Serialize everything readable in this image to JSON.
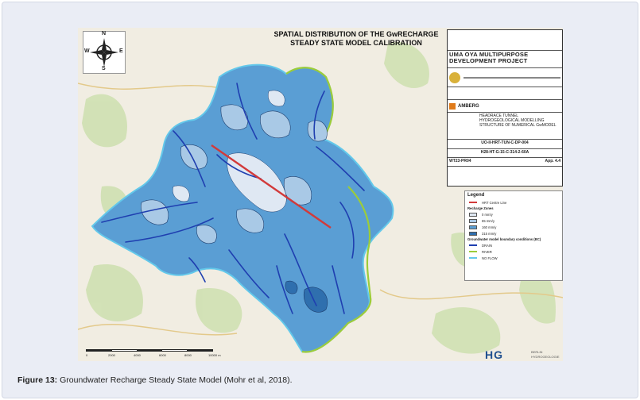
{
  "map": {
    "title_line1": "SPATIAL DISTRIBUTION OF THE GwRECHARGE",
    "title_line2": "STEADY STATE MODEL CALIBRATION",
    "compass": {
      "north": "N",
      "south": "S",
      "east": "E",
      "west": "W"
    },
    "scale_labels": [
      "0",
      "2000",
      "4000",
      "6000",
      "8000",
      "10000 m"
    ],
    "colors": {
      "zone_0": "#dfe8f3",
      "zone_65": "#a9c9e6",
      "zone_160": "#5a9ed4",
      "zone_315": "#2f6fae",
      "hrt_line": "#d23a3a",
      "drain": "#1f3fb0",
      "river": "#9ccc3a",
      "no_flow": "#63c8ea"
    }
  },
  "title_block": {
    "project_line1": "UMA OYA MULTIPURPOSE",
    "project_line2": "DEVELOPMENT PROJECT",
    "company": "AMBERG",
    "drawing_line1": "HEADRACE TUNNEL",
    "drawing_line2": "HYDROGEOLOGICAL MODELLING",
    "drawing_line3": "STRUCTURE OF NUMERICAL GwMODEL",
    "ref1": "UO-II-HRT-TUN-C-DP-004",
    "ref2": "H28-HT-G-15-C-314-2-60A",
    "ref3": "WT23-PR04",
    "ref4": "App. 4.4"
  },
  "legend": {
    "title": "Legend",
    "hrt_label": "HRT Centre Line",
    "zones_title": "Recharge Zones",
    "zones": [
      "0 mm/y",
      "65 mm/y",
      "160 mm/y",
      "315 mm/y"
    ],
    "bc_title": "Groundwater model boundary conditions (BC)",
    "bc_items": [
      "DRAIN",
      "RIVER",
      "NO FLOW"
    ]
  },
  "logo": {
    "mark": "HG",
    "line1": "BERLIN",
    "line2": "HYDROGEOLOGIE"
  },
  "caption": {
    "label": "Figure 13:",
    "text": " Groundwater Recharge Steady State Model (Mohr et al, 2018)."
  }
}
